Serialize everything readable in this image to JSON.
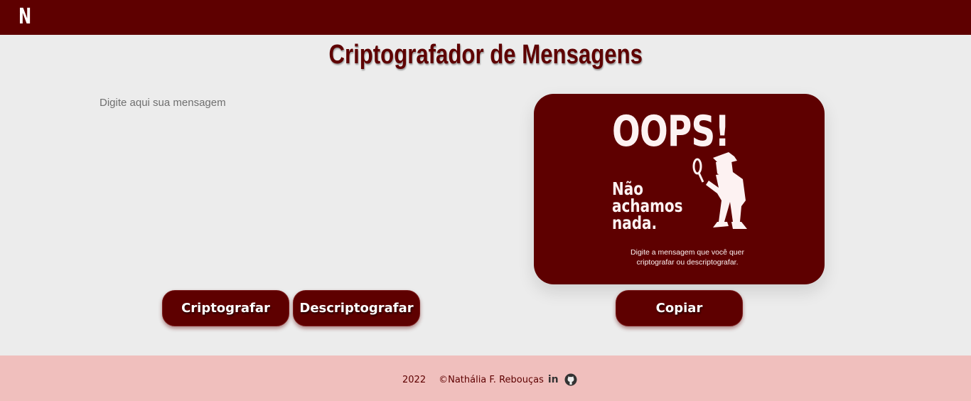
{
  "header": {
    "logo_text": "N"
  },
  "main": {
    "title": "Criptografador de Mensagens",
    "input": {
      "placeholder": "Digite aqui sua mensagem",
      "value": ""
    },
    "buttons": {
      "encrypt_label": "Criptografar",
      "decrypt_label": "Descriptografar",
      "copy_label": "Copiar"
    },
    "result_card": {
      "headline": "OOPS!",
      "not_found": "Não achamos nada.",
      "hint": "Digite a mensagem que você quer criptografar ou descriptografar.",
      "illustration_icon": "detective-icon"
    }
  },
  "footer": {
    "year": "2022",
    "author": "©Nathália F. Rebouças",
    "linkedin_icon_text": "in",
    "icons": [
      "linkedin-icon",
      "github-icon"
    ]
  },
  "colors": {
    "brand": "#5e0000",
    "background": "#ececec",
    "footer_bg": "#f0bfbd",
    "card_text": "#fdf2f2"
  }
}
